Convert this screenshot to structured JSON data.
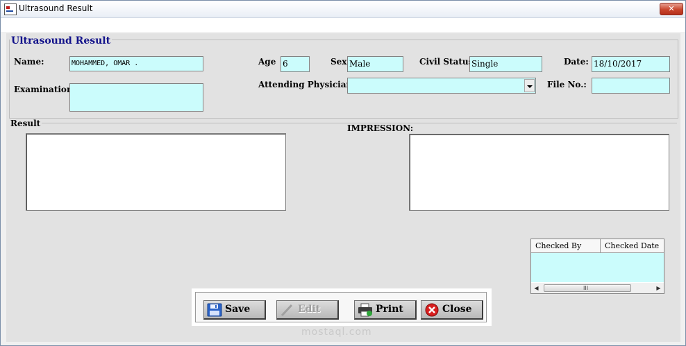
{
  "window": {
    "title": "Ultrasound Result",
    "close_glyph": "✕",
    "icon": "app-form-icon"
  },
  "form": {
    "group_title": "Ultrasound Result",
    "name_label": "Name:",
    "name_value": "MOHAMMED, OMAR  .",
    "age_label": "Age",
    "age_value": "6",
    "sex_label": "Sex",
    "sex_value": "Male",
    "civil_status_label": "Civil Status",
    "civil_status_value": "Single",
    "date_label": "Date:",
    "date_value": "18/10/2017",
    "examination_label": "Examination:",
    "examination_value": "",
    "physician_label": "Attending Physician:",
    "physician_value": "",
    "file_no_label": "File No.:",
    "file_no_value": ""
  },
  "result": {
    "result_label": "Result",
    "impression_label": "IMPRESSION:"
  },
  "checked_grid": {
    "columns": [
      "Checked By",
      "Checked Date"
    ],
    "scroll_grip": "III"
  },
  "toolbar": {
    "save_label": "Save",
    "edit_label": "Edit",
    "print_label": "Print",
    "close_label": "Close"
  },
  "watermark": "mostaql.com",
  "colors": {
    "field_bg": "#cbfcfc",
    "legend_text": "#12128a",
    "panel_bg": "#e2e2e2",
    "close_button": "#c9462d"
  }
}
